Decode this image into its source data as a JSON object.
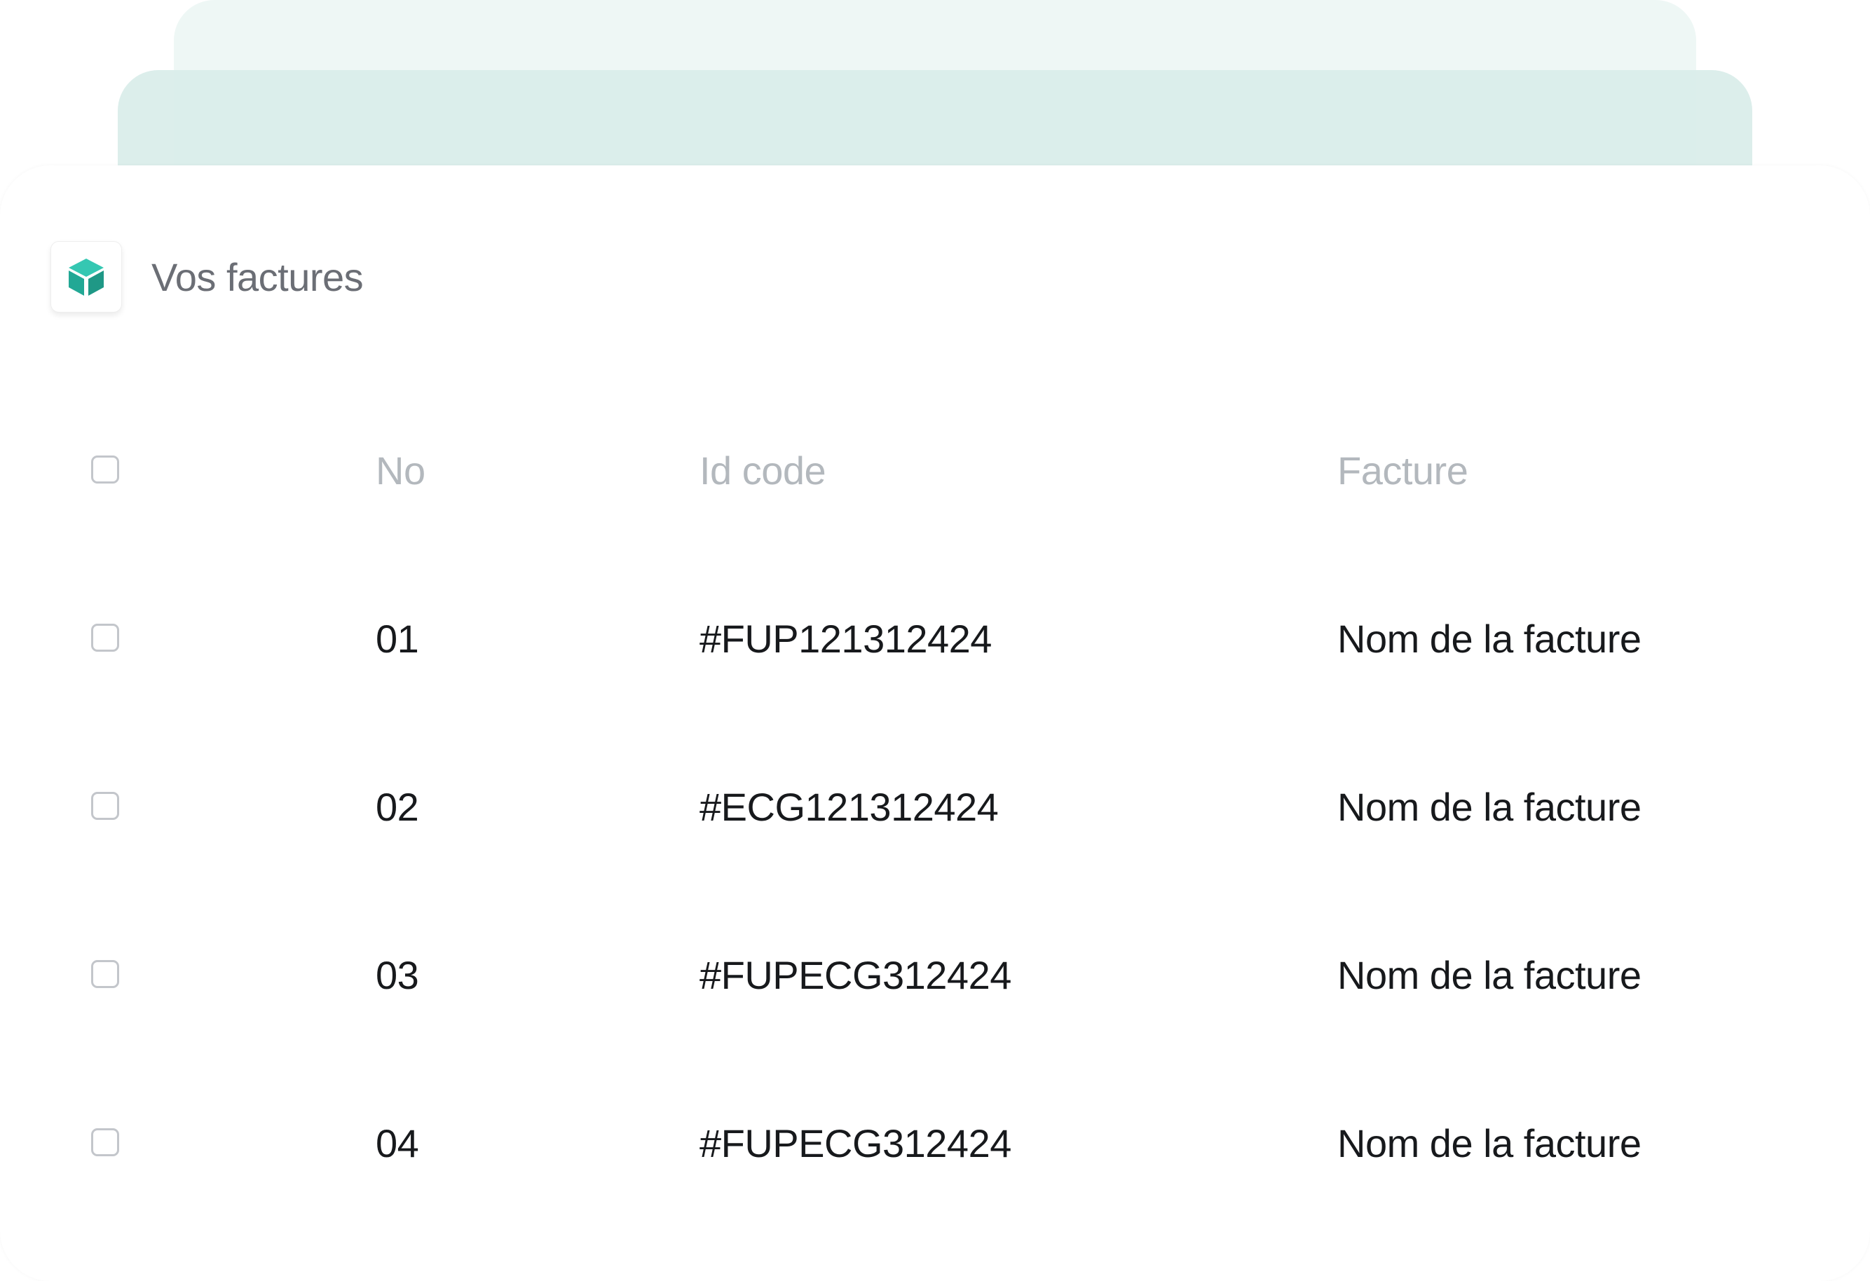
{
  "card": {
    "title": "Vos factures",
    "icon": "cube-icon",
    "accent_color": "#2bb3a0"
  },
  "table": {
    "columns": [
      "No",
      "Id code",
      "Facture"
    ],
    "rows": [
      {
        "no": "01",
        "id_code": "#FUP121312424",
        "facture": "Nom de la facture",
        "checked": false
      },
      {
        "no": "02",
        "id_code": "#ECG121312424",
        "facture": "Nom de la facture",
        "checked": false
      },
      {
        "no": "03",
        "id_code": "#FUPECG312424",
        "facture": "Nom de la facture",
        "checked": false
      },
      {
        "no": "04",
        "id_code": "#FUPECG312424",
        "facture": "Nom de la facture",
        "checked": false
      }
    ]
  }
}
